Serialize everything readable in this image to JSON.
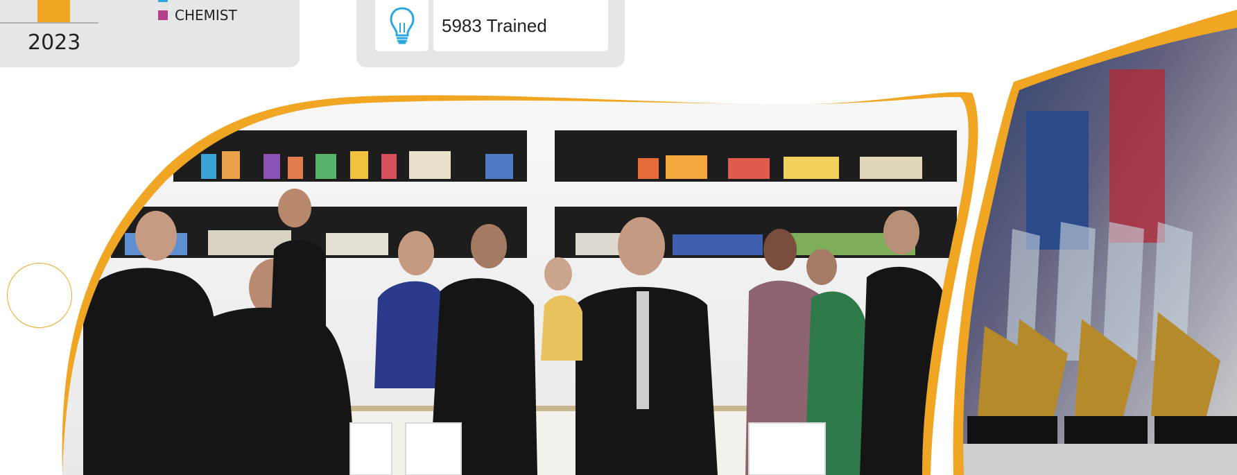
{
  "chart_card": {
    "year_label": "2023",
    "legend_label": "CHEMIST",
    "colors": {
      "bar": "#f0a623",
      "legend_top": "#29a8e0",
      "legend_swatch": "#b3408f"
    }
  },
  "stat_card": {
    "icon": "lightbulb-icon",
    "value_label": "5983 Trained",
    "icon_color": "#29a8e0"
  },
  "banner": {
    "left_photo": "exhibition-booth-photo",
    "right_photo": "awards-trophies-photo",
    "accent_color": "#f0a623"
  }
}
